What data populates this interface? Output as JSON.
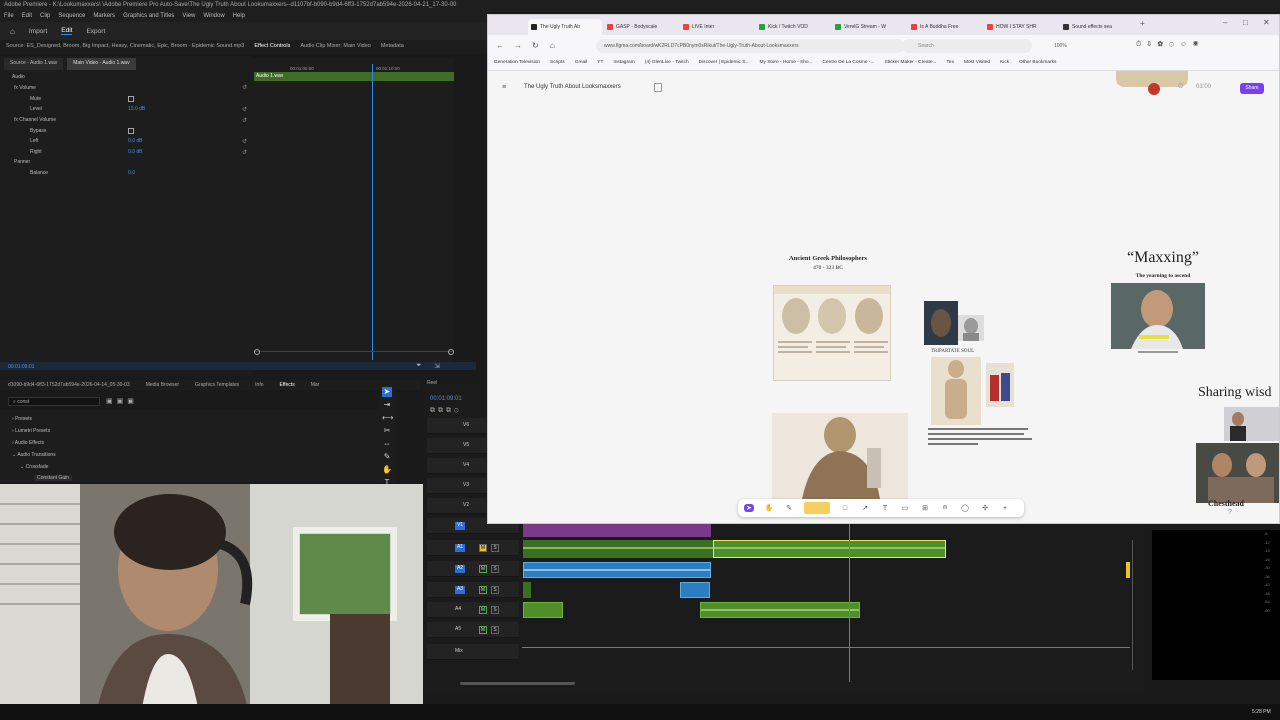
{
  "premiere": {
    "title_bar": "Adobe Premiere - K:\\Lookumaxxers\\ \\Adobe Premiere Pro Auto-Save\\The Ugly Truth About Lookumaxxers--d1107bf-b090-b9d4-6ff3-1752d7ab594e-2026-04-21_17-30-00",
    "menu": [
      "File",
      "Edit",
      "Clip",
      "Sequence",
      "Markers",
      "Graphics and Titles",
      "View",
      "Window",
      "Help"
    ],
    "workspace": {
      "home": "Home",
      "import": "Import",
      "edit": "Edit",
      "export": "Export"
    },
    "source_tabs": [
      "Source: ES_Designed, Broom, Big Impact, Heavy, Cinematic, Epic, Broom - Epidemic Sound.mp3",
      "Effect Controls",
      "Audio Clip Mixer: Main Video",
      "Metadata"
    ],
    "clip_tabs": [
      "Source - Audio 1.wav",
      "Main Video - Audio 1.wav"
    ],
    "fx_rows": [
      {
        "label": "Audio",
        "value": ""
      },
      {
        "label": "fx Volume",
        "value": ""
      },
      {
        "label": "Mute",
        "value": ""
      },
      {
        "label": "Level",
        "value": "13.0 dB"
      },
      {
        "label": "fx Channel Volume",
        "value": ""
      },
      {
        "label": "Bypass",
        "value": ""
      },
      {
        "label": "Left",
        "value": "0.0 dB"
      },
      {
        "label": "Right",
        "value": "0.0 dB"
      },
      {
        "label": "Panner",
        "value": ""
      },
      {
        "label": "Balance",
        "value": "0.0"
      }
    ],
    "fx_timecodes": {
      "start": "00:01:05:00",
      "end": "00:01:10:00"
    },
    "fx_clip_label": "Audio 1.wav",
    "fx_time": "00:01:09:01",
    "effects_tabs": [
      "d1090-b9d4-6ff3-1752d7ab594e-2026-04-14_05-30-03",
      "Media Browser",
      "Graphics Templates",
      "Info",
      "Effects",
      "Mar"
    ],
    "effects_search": "const",
    "effects_list": [
      "Presets",
      "Lumetri Presets",
      "Audio Effects",
      "Audio Transitions",
      "Crossfade",
      "Constant Gain"
    ],
    "timeline_tab": "Reel",
    "timeline_time": "00:01:09:01",
    "tracks": [
      "V6",
      "V5",
      "V4",
      "V3",
      "V2",
      "V1",
      "A1",
      "A2",
      "A3",
      "A4",
      "A5",
      "Mix"
    ],
    "clock": "5:28 PM"
  },
  "browser": {
    "tabs": [
      {
        "label": "The Ugly Truth Ab",
        "color": "#222222"
      },
      {
        "label": "GASP - Bodyscale",
        "color": "#e8453c"
      },
      {
        "label": "LIVE Inter",
        "color": "#e8453c"
      },
      {
        "label": "Kick / Twitch VOD",
        "color": "#26a042"
      },
      {
        "label": "VerelG Stream - W",
        "color": "#26a042"
      },
      {
        "label": "Is A Buddha Free",
        "color": "#e8453c"
      },
      {
        "label": "HOW I STAY SHR",
        "color": "#e8453c"
      },
      {
        "label": "Sound effects sea",
        "color": "#333333"
      }
    ],
    "url": "www.figma.com/board/wK2RLD7cPB0nym0sRikut/The-Ugly-Truth-About-Looksmaxxers",
    "search_placeholder": "Search",
    "zoom": "100%",
    "bookmarks": [
      "Generation Television",
      "Scripts",
      "Gmail",
      "YT",
      "Instagram",
      "(4) GlenLive - Twitch",
      "Discover | Epidemic S...",
      "My Store - Home - Sho...",
      "Centre De La Cosme -...",
      "Sticker Maker - Create...",
      "Tex",
      "Most Visited",
      "Kick",
      "Other Bookmarks"
    ]
  },
  "figma": {
    "file_name": "The Ugly Truth About Looksmaxxers",
    "timer": "03:00",
    "share_label": "Share",
    "philosophers_title": "Ancient Greek Philosophers",
    "philosophers_dates": "470 - 323 BC",
    "tripartite_label": "TRIPARTATE SOUL",
    "maxxing_title": "“Maxxing”",
    "maxxing_sub": "The yearning to ascend",
    "sharing_title": "Sharing wisd",
    "chesthead_label": "Chesthead"
  }
}
